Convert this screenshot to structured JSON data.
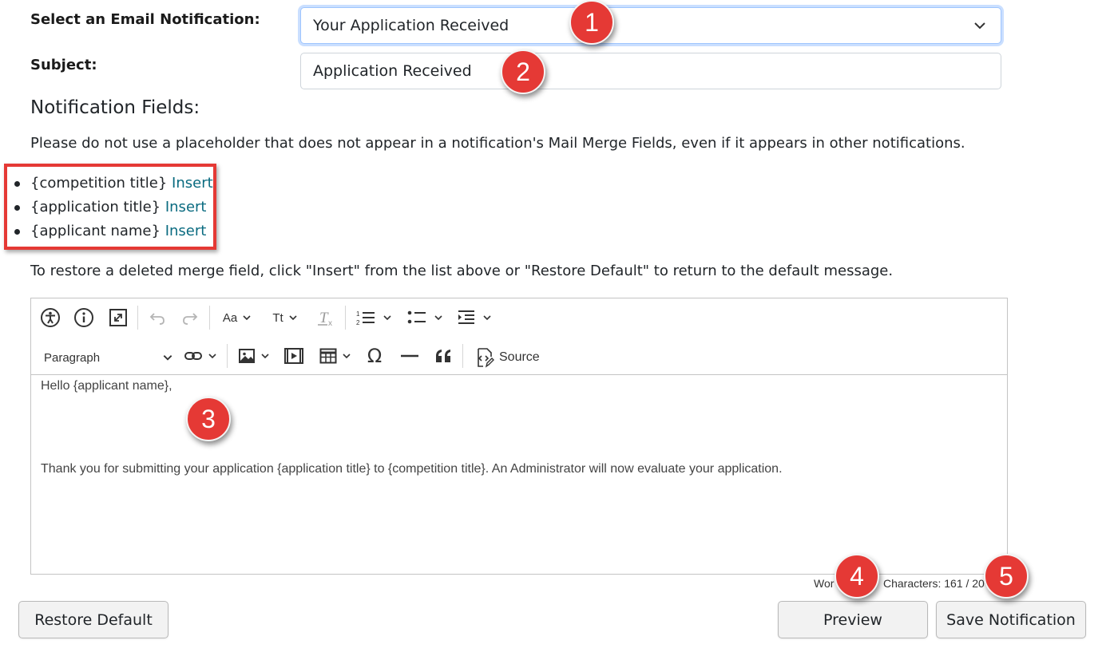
{
  "form": {
    "email_notification_label": "Select an Email Notification:",
    "email_notification_value": "Your Application Received",
    "subject_label": "Subject:",
    "subject_value": "Application Received"
  },
  "notification_fields": {
    "title": "Notification Fields:",
    "warning_text": "Please do not use a placeholder that does not appear in a notification's Mail Merge Fields, even if it appears in other notifications.",
    "items": [
      {
        "placeholder": "{competition title}",
        "link": "Insert"
      },
      {
        "placeholder": "{application title}",
        "link": "Insert"
      },
      {
        "placeholder": "{applicant name}",
        "link": "Insert"
      }
    ],
    "restore_hint": "To restore a deleted merge field, click \"Insert\" from the list above or \"Restore Default\" to return to the default message."
  },
  "editor": {
    "toolbar": {
      "icons": [
        "accessibility-icon",
        "info-icon",
        "fullscreen-icon",
        "undo-icon",
        "redo-icon",
        "font-family-icon",
        "font-size-icon",
        "remove-format-icon",
        "numbered-list-icon",
        "bulleted-list-icon",
        "indent-icon",
        "link-icon",
        "image-icon",
        "media-icon",
        "table-icon",
        "special-characters-icon",
        "horizontal-line-icon",
        "block-quote-icon",
        "source-icon"
      ],
      "font_family_label": "Aa",
      "font_size_label": "Tt",
      "paragraph_label": "Paragraph",
      "source_label": "Source"
    },
    "content": {
      "greeting": "Hello {applicant name},",
      "body": "Thank you for submitting your application {application title} to {competition title}. An Administrator will now evaluate your application."
    },
    "word_count_text": "Wor",
    "char_count_text": "Characters: 161 / 20"
  },
  "buttons": {
    "restore_default": "Restore Default",
    "preview": "Preview",
    "save_notification": "Save Notification"
  },
  "callouts": [
    "1",
    "2",
    "3",
    "4",
    "5"
  ],
  "colors": {
    "callout_red": "#e53935",
    "link": "#0a6b80",
    "focus_border": "#9ec5fe"
  }
}
